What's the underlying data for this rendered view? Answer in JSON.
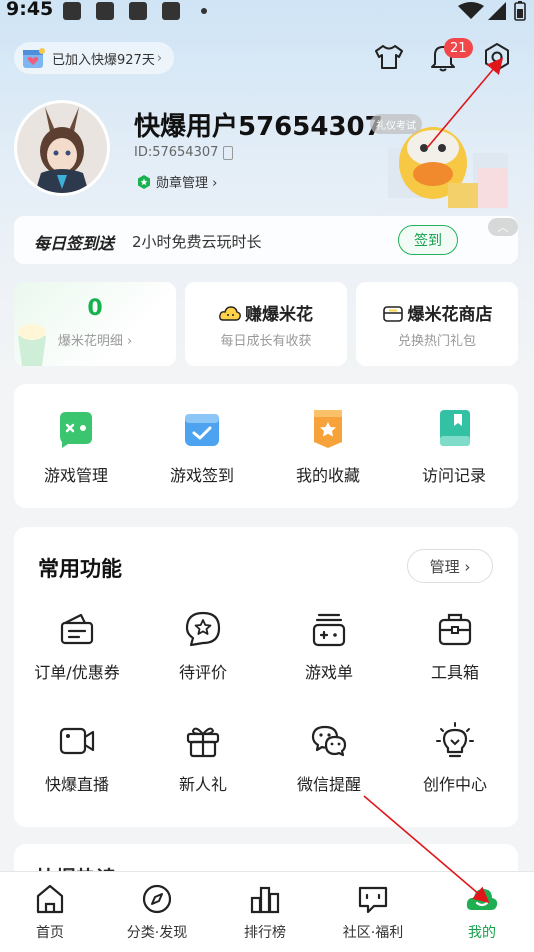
{
  "status_bar": {
    "time": "9:45"
  },
  "header": {
    "joined_text": "已加入快爆927天",
    "joined_arrow": "›",
    "notification_count": "21"
  },
  "profile": {
    "username": "快爆用户57654307",
    "tag": "礼仪考试",
    "user_id": "ID:57654307",
    "badge_manage": "勋章管理 ›"
  },
  "signin": {
    "title": "每日签到送",
    "desc": "2小时免费云玩时长",
    "button": "签到"
  },
  "mini_cards": [
    {
      "value": "0",
      "sub": "爆米花明细 ›"
    },
    {
      "title": "赚爆米花",
      "sub": "每日成长有收获",
      "icon": "popcorn-cloud-icon"
    },
    {
      "title": "爆米花商店",
      "sub": "兑换热门礼包",
      "icon": "shop-icon"
    }
  ],
  "quick_access": [
    {
      "label": "游戏管理",
      "icon": "gamepad-icon"
    },
    {
      "label": "游戏签到",
      "icon": "checkin-icon"
    },
    {
      "label": "我的收藏",
      "icon": "star-bookmark-icon"
    },
    {
      "label": "访问记录",
      "icon": "history-book-icon"
    }
  ],
  "common_functions": {
    "title": "常用功能",
    "manage": "管理 ›",
    "items": [
      {
        "label": "订单/优惠券",
        "icon": "coupon-icon"
      },
      {
        "label": "待评价",
        "icon": "review-star-icon"
      },
      {
        "label": "游戏单",
        "icon": "game-list-icon"
      },
      {
        "label": "工具箱",
        "icon": "toolbox-icon"
      },
      {
        "label": "快爆直播",
        "icon": "live-camera-icon"
      },
      {
        "label": "新人礼",
        "icon": "gift-icon"
      },
      {
        "label": "微信提醒",
        "icon": "wechat-icon"
      },
      {
        "label": "创作中心",
        "icon": "lightbulb-icon"
      }
    ]
  },
  "next_section": {
    "title": "快爆热读"
  },
  "bottom_nav": [
    {
      "label": "首页",
      "icon": "home-icon"
    },
    {
      "label": "分类·发现",
      "icon": "compass-icon"
    },
    {
      "label": "排行榜",
      "icon": "ranking-icon"
    },
    {
      "label": "社区·福利",
      "icon": "community-icon"
    },
    {
      "label": "我的",
      "icon": "profile-cloud-icon",
      "active": true
    }
  ],
  "colors": {
    "accent_green": "#19b04f",
    "badge_red": "#f0474a",
    "annotation_red": "#e0161b"
  }
}
